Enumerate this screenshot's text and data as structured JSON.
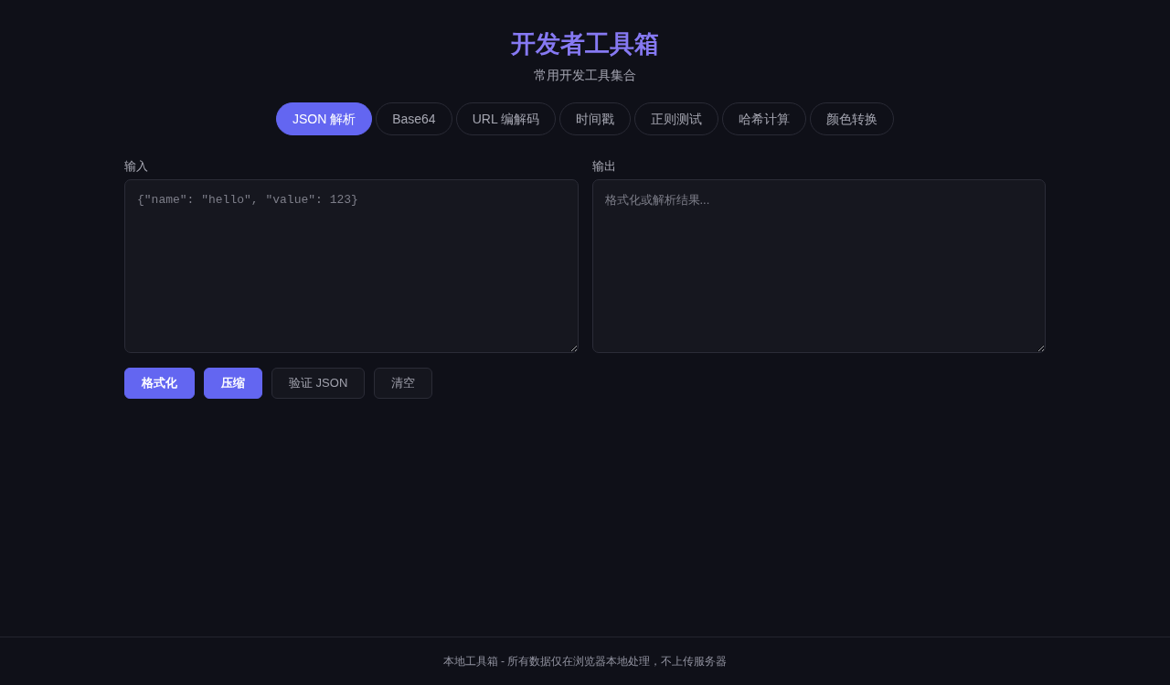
{
  "header": {
    "title": "开发者工具箱",
    "subtitle": "常用开发工具集合"
  },
  "tabs": [
    {
      "label": "JSON 解析",
      "selected": true
    },
    {
      "label": "Base64",
      "selected": false
    },
    {
      "label": "URL 编解码",
      "selected": false
    },
    {
      "label": "时间戳",
      "selected": false
    },
    {
      "label": "正则测试",
      "selected": false
    },
    {
      "label": "哈希计算",
      "selected": false
    },
    {
      "label": "颜色转换",
      "selected": false
    }
  ],
  "panels": [
    {
      "label": "输入",
      "placeholder": "{\"name\": \"hello\", \"value\": 123}",
      "kind": "input"
    },
    {
      "label": "输出",
      "placeholder": "格式化或解析结果...",
      "kind": "output"
    }
  ],
  "actions": [
    {
      "label": "格式化",
      "kind": "primary"
    },
    {
      "label": "压缩",
      "kind": "primary"
    },
    {
      "label": "验证 JSON",
      "kind": "secondary"
    },
    {
      "label": "清空",
      "kind": "secondary"
    }
  ],
  "footer": {
    "text": "本地工具箱 - 所有数据仅在浏览器本地处理，不上传服务器"
  }
}
